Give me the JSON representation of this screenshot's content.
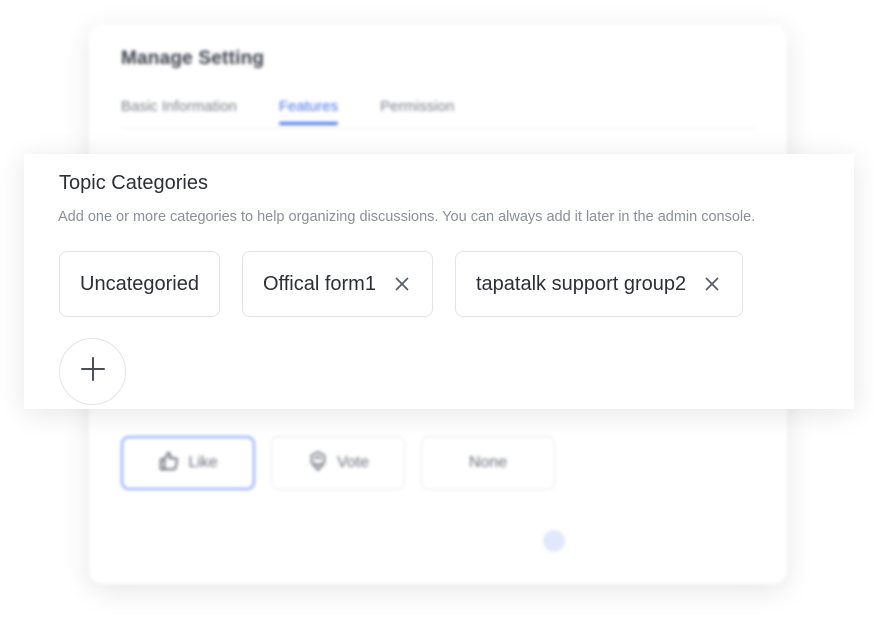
{
  "background": {
    "title": "Manage Setting",
    "tabs": [
      {
        "label": "Basic Information",
        "active": false
      },
      {
        "label": "Features",
        "active": true
      },
      {
        "label": "Permission",
        "active": false
      }
    ],
    "reaction_options": [
      {
        "label": "Like",
        "icon": "thumbs-up-icon",
        "selected": true
      },
      {
        "label": "Vote",
        "icon": "vote-icon",
        "selected": false
      },
      {
        "label": "None",
        "icon": "",
        "selected": false
      }
    ]
  },
  "topic_categories": {
    "title": "Topic Categories",
    "description": "Add one or more categories to help organizing discussions. You can always add it later in the admin console.",
    "chips": [
      {
        "label": "Uncategoried",
        "removable": false
      },
      {
        "label": "Offical form1",
        "removable": true
      },
      {
        "label": "tapatalk support group2",
        "removable": true
      }
    ],
    "add_icon": "plus-icon"
  },
  "colors": {
    "accent": "#4a74e8",
    "text": "#2c2f36",
    "muted": "#8a8f99",
    "border": "#e3e5ea"
  }
}
